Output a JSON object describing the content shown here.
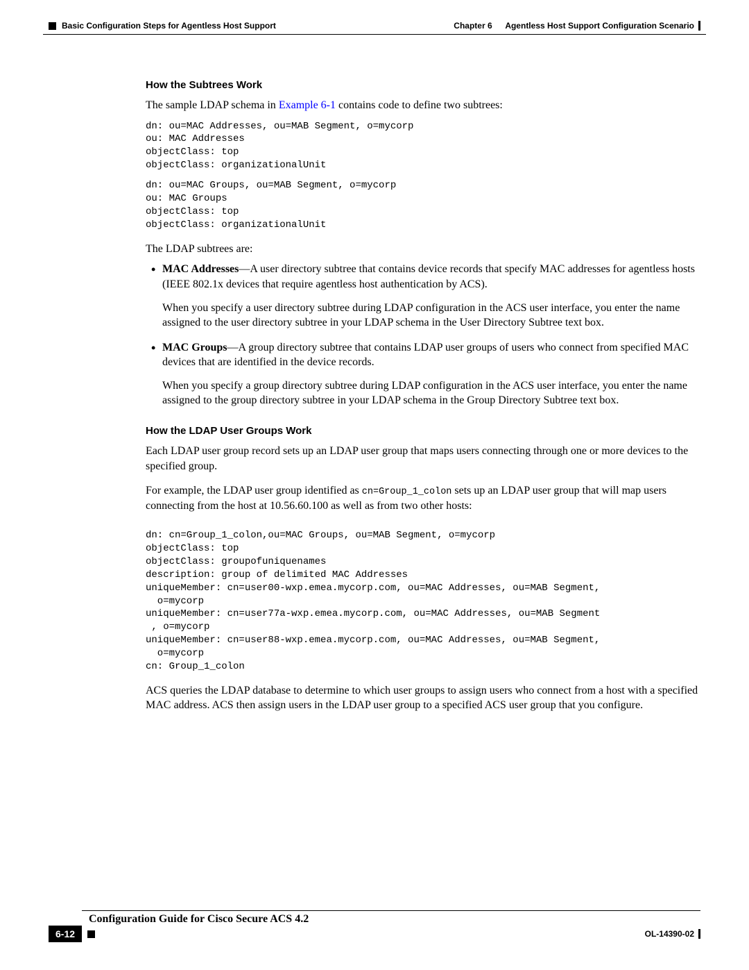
{
  "header": {
    "section_title": "Basic Configuration Steps for Agentless Host Support",
    "chapter_label": "Chapter 6",
    "chapter_title": "Agentless Host Support Configuration Scenario"
  },
  "section1": {
    "heading": "How the Subtrees Work",
    "intro_prefix": "The sample LDAP schema in ",
    "intro_link": "Example 6-1",
    "intro_suffix": " contains code to define two subtrees:",
    "code1": "dn: ou=MAC Addresses, ou=MAB Segment, o=mycorp\nou: MAC Addresses\nobjectClass: top\nobjectClass: organizationalUnit",
    "code2": "dn: ou=MAC Groups, ou=MAB Segment, o=mycorp\nou: MAC Groups\nobjectClass: top\nobjectClass: organizationalUnit",
    "subtrees_intro": "The LDAP subtrees are:",
    "bullets": [
      {
        "term": "MAC Addresses",
        "desc": "—A user directory subtree that contains device records that specify MAC addresses for agentless hosts (IEEE 802.1x devices that require agentless host authentication by ACS).",
        "para2": "When you specify a user directory subtree during LDAP configuration in the ACS user interface, you enter the name assigned to the user directory subtree in your LDAP schema in the User Directory Subtree text box."
      },
      {
        "term": "MAC Groups",
        "desc": "—A group directory subtree that contains LDAP user groups of users who connect from specified MAC devices that are identified in the device records.",
        "para2": "When you specify a group directory subtree during LDAP configuration in the ACS user interface, you enter the name assigned to the group directory subtree in your LDAP schema in the Group Directory Subtree text box."
      }
    ]
  },
  "section2": {
    "heading": "How the LDAP User Groups Work",
    "para1": "Each LDAP user group record sets up an LDAP user group that maps users connecting through one or more devices to the specified group.",
    "para2_prefix": "For example, the LDAP user group identified as ",
    "para2_code": "cn=Group_1_colon",
    "para2_suffix": " sets up an LDAP user group that will map users connecting from the host at 10.56.60.100 as well as from two other hosts:",
    "code": "dn: cn=Group_1_colon,ou=MAC Groups, ou=MAB Segment, o=mycorp\nobjectClass: top\nobjectClass: groupofuniquenames\ndescription: group of delimited MAC Addresses\nuniqueMember: cn=user00-wxp.emea.mycorp.com, ou=MAC Addresses, ou=MAB Segment,\n  o=mycorp\nuniqueMember: cn=user77a-wxp.emea.mycorp.com, ou=MAC Addresses, ou=MAB Segment\n , o=mycorp\nuniqueMember: cn=user88-wxp.emea.mycorp.com, ou=MAC Addresses, ou=MAB Segment,\n  o=mycorp\ncn: Group_1_colon",
    "para3": "ACS queries the LDAP database to determine to which user groups to assign users who connect from a host with a specified MAC address. ACS then assign users in the LDAP user group to a specified ACS user group that you configure."
  },
  "footer": {
    "doc_title": "Configuration Guide for Cisco Secure ACS 4.2",
    "page_num": "6-12",
    "doc_id": "OL-14390-02"
  }
}
